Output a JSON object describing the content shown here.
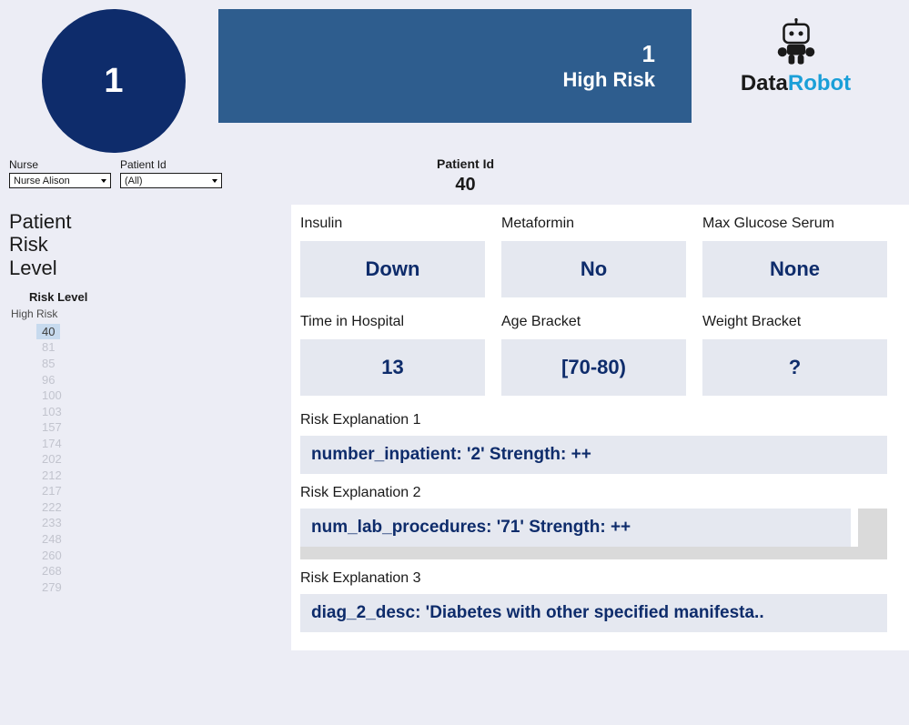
{
  "summary": {
    "count": "1",
    "banner_count": "1",
    "banner_label": "High Risk"
  },
  "logo": {
    "prefix": "Data",
    "suffix": "Robot"
  },
  "filters": {
    "nurse_label": "Nurse",
    "nurse_value": "Nurse Alison",
    "patient_id_label": "Patient Id",
    "patient_id_value": "(All)"
  },
  "patient_id_header": {
    "label": "Patient Id",
    "value": "40"
  },
  "sidebar": {
    "title_line1": "Patient",
    "title_line2": "Risk",
    "title_line3": "Level",
    "risk_level_label": "Risk Level",
    "risk_group": "High Risk",
    "patient_ids": [
      "40",
      "81",
      "85",
      "96",
      "100",
      "103",
      "157",
      "174",
      "202",
      "212",
      "217",
      "222",
      "233",
      "248",
      "260",
      "268",
      "279"
    ],
    "selected_index": 0
  },
  "metrics": {
    "row1": [
      {
        "label": "Insulin",
        "value": "Down"
      },
      {
        "label": "Metaformin",
        "value": "No"
      },
      {
        "label": "Max Glucose Serum",
        "value": "None"
      }
    ],
    "row2": [
      {
        "label": "Time in Hospital",
        "value": "13"
      },
      {
        "label": "Age Bracket",
        "value": "[70-80)"
      },
      {
        "label": "Weight Bracket",
        "value": "?"
      }
    ]
  },
  "explanations": [
    {
      "label": "Risk Explanation 1",
      "text": "number_inpatient: '2'  Strength:  ++"
    },
    {
      "label": "Risk Explanation 2",
      "text": "num_lab_procedures: '71'   Strength:  ++"
    },
    {
      "label": "Risk Explanation 3",
      "text": "diag_2_desc: 'Diabetes with other specified manifesta.."
    }
  ]
}
